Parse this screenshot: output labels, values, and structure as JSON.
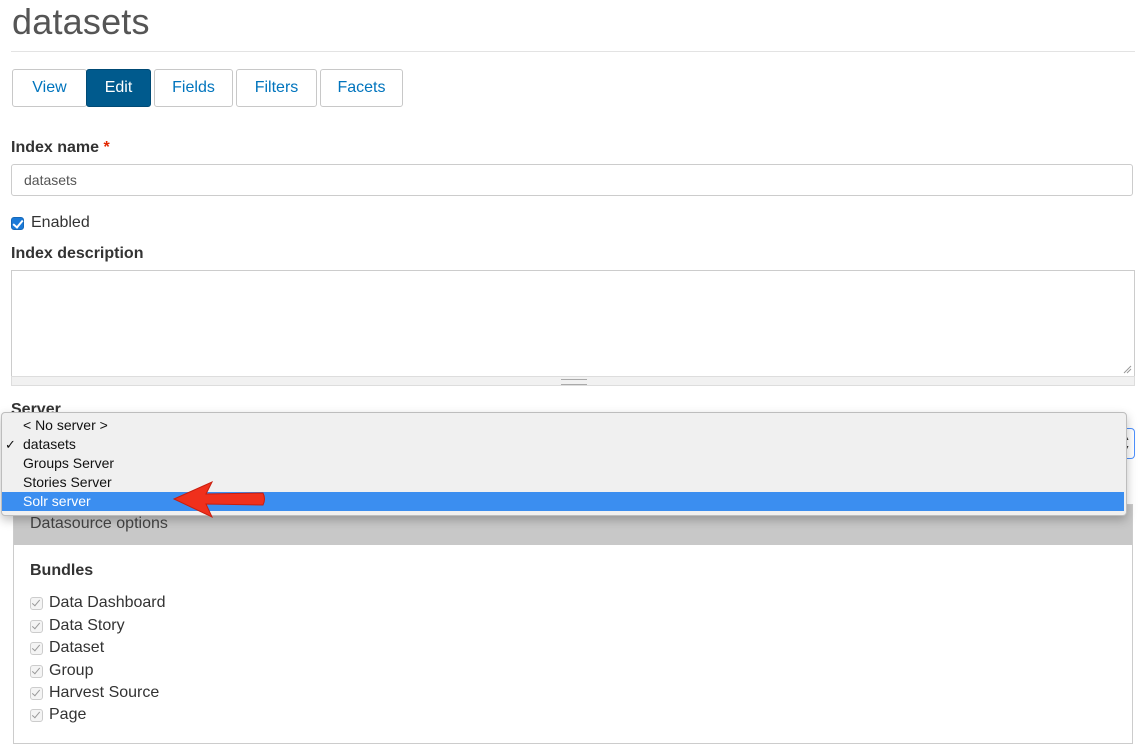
{
  "page": {
    "title": "datasets"
  },
  "tabs": [
    {
      "label": "View",
      "active": false
    },
    {
      "label": "Edit",
      "active": true
    },
    {
      "label": "Fields",
      "active": false
    },
    {
      "label": "Filters",
      "active": false
    },
    {
      "label": "Facets",
      "active": false
    }
  ],
  "form": {
    "index_name_label": "Index name",
    "required_marker": "*",
    "index_name_value": "datasets",
    "enabled_label": "Enabled",
    "enabled_checked": true,
    "index_description_label": "Index description",
    "index_description_value": "",
    "server_label": "Server"
  },
  "server_dropdown": {
    "options": [
      "< No server >",
      "datasets",
      "Groups Server",
      "Stories Server",
      "Solr server"
    ],
    "checked_option": "datasets",
    "highlighted_option": "Solr server",
    "check_glyph": "✓"
  },
  "datasource": {
    "title": "Datasource options",
    "bundles_label": "Bundles",
    "bundles": [
      "Data Dashboard",
      "Data Story",
      "Dataset",
      "Group",
      "Harvest Source",
      "Page"
    ]
  },
  "colors": {
    "active_tab": "#005a8d",
    "link": "#0074bd",
    "highlight": "#3b8ef0",
    "required": "#e32700",
    "annotation_arrow": "#f0301c"
  }
}
